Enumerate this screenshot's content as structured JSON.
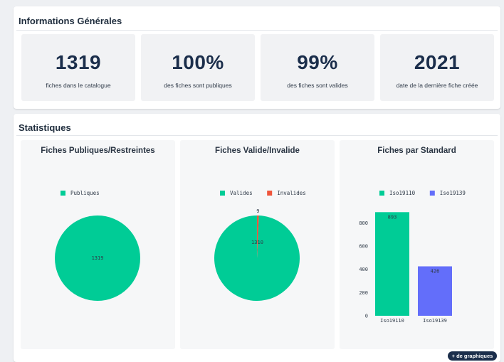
{
  "info": {
    "title": "Informations Générales",
    "kpis": [
      {
        "value": "1319",
        "label": "fiches dans le catalogue"
      },
      {
        "value": "100%",
        "label": "des fiches sont publiques"
      },
      {
        "value": "99%",
        "label": "des fiches sont valides"
      },
      {
        "value": "2021",
        "label": "date de la dernière fiche créée"
      }
    ]
  },
  "stats": {
    "title": "Statistiques",
    "more_button": "+ de graphiques"
  },
  "chart_data": [
    {
      "type": "pie",
      "title": "Fiches Publiques/Restreintes",
      "labels": [
        "Publiques"
      ],
      "values": [
        1319
      ],
      "colors": [
        "#00cc96"
      ],
      "legend_position": "top"
    },
    {
      "type": "pie",
      "title": "Fiches Valide/Invalide",
      "labels": [
        "Valides",
        "Invalides"
      ],
      "values": [
        1310,
        9
      ],
      "colors": [
        "#00cc96",
        "#ef553b"
      ],
      "legend_position": "top"
    },
    {
      "type": "bar",
      "title": "Fiches par Standard",
      "categories": [
        "Iso19110",
        "Iso19139"
      ],
      "series": [
        {
          "name": "Iso19110",
          "values": [
            893
          ],
          "color": "#00cc96"
        },
        {
          "name": "Iso19139",
          "values": [
            426
          ],
          "color": "#636efa"
        }
      ],
      "ylim": [
        0,
        950
      ],
      "yticks": [
        0,
        200,
        400,
        600,
        800
      ],
      "grid": false,
      "legend_position": "top"
    }
  ]
}
